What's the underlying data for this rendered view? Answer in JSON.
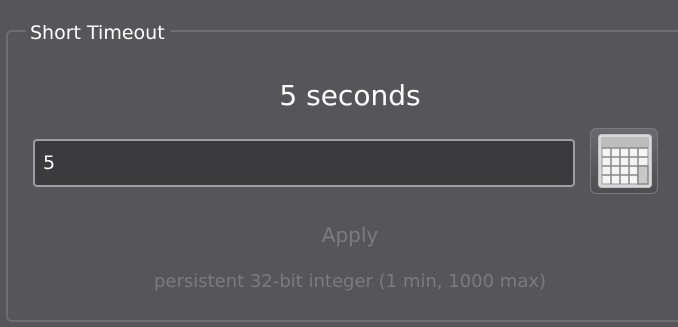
{
  "group": {
    "title": "Short Timeout"
  },
  "value_display": "5 seconds",
  "input": {
    "value": "5"
  },
  "keypad": {
    "icon": "keypad-icon"
  },
  "apply_label": "Apply",
  "type_description": "persistent 32-bit integer (1 min, 1000 max)",
  "colors": {
    "panel_background": "#55555a",
    "frame_border": "#6e6e72",
    "input_background": "#3b3b3d",
    "disabled_text": "#7b7b80"
  }
}
